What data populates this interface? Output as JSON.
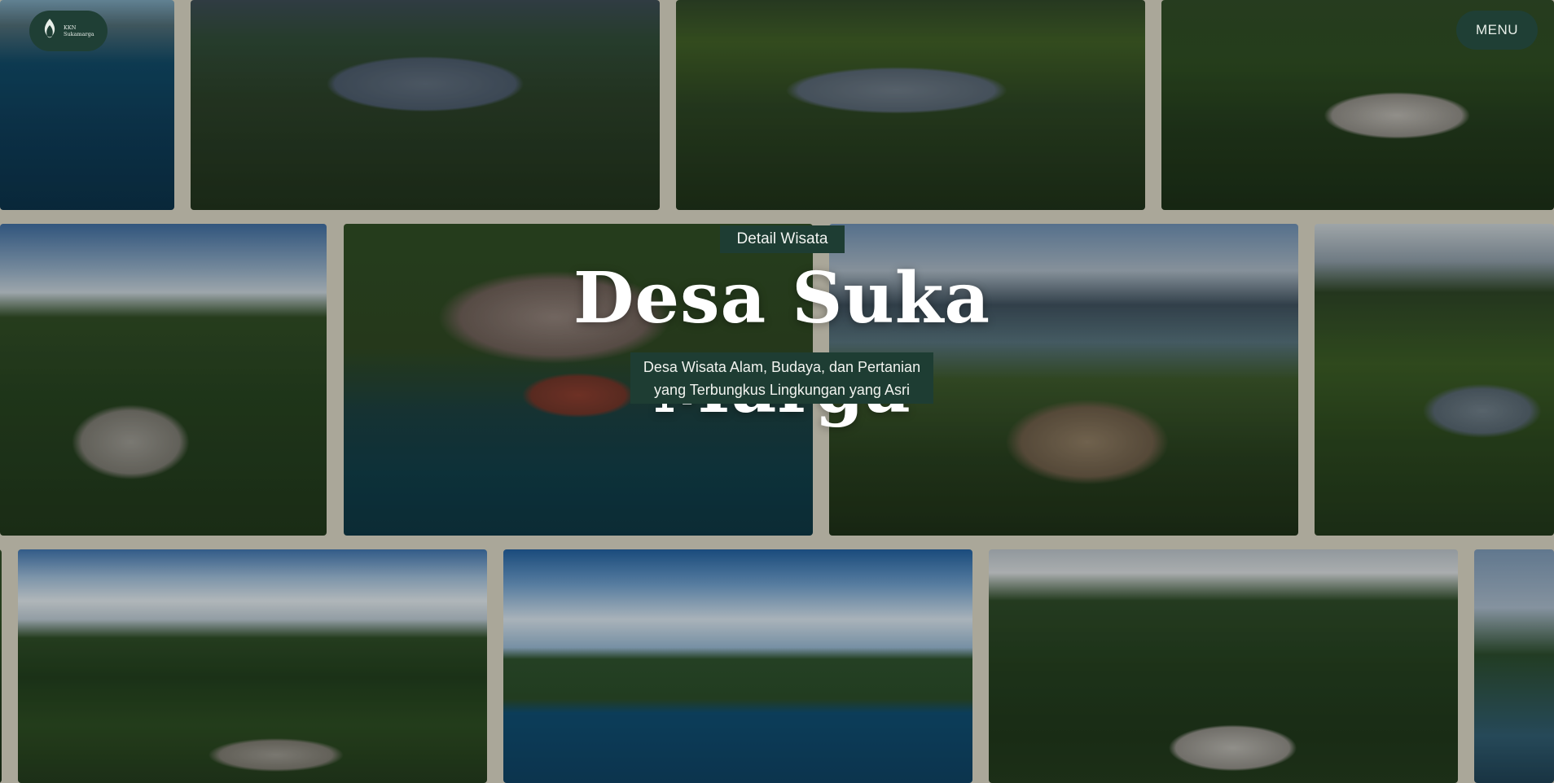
{
  "brand": {
    "logo_line1": "KKN",
    "logo_line2": "Sukamarga"
  },
  "nav": {
    "menu_label": "MENU"
  },
  "hero": {
    "badge": "Detail Wisata",
    "title": "Desa Suka Marga",
    "subtitle_line1": "Desa Wisata Alam, Budaya, dan Pertanian",
    "subtitle_line2": "yang Terbungkus Lingkungan yang Asri"
  },
  "colors": {
    "background": "#d8d3c1",
    "accent": "#1e3d33"
  },
  "icons": {
    "logo": "leaf-flame-icon"
  }
}
